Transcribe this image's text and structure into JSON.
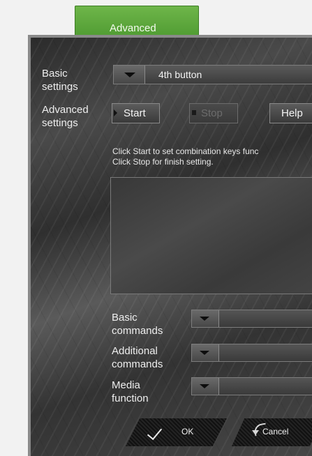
{
  "tab": {
    "label": "Advanced"
  },
  "basic": {
    "label_line1": "Basic",
    "label_line2": "settings",
    "combo_value": "4th button"
  },
  "advanced": {
    "label_line1": "Advanced",
    "label_line2": "settings",
    "start_label": "Start",
    "stop_label": "Stop",
    "help_label": "Help"
  },
  "hint": {
    "line1": "Click Start to set combination keys func",
    "line2": " Click Stop for finish setting."
  },
  "commands": {
    "basic_line1": "Basic",
    "basic_line2": "commands",
    "additional_line1": "Additional",
    "additional_line2": "commands",
    "media_line1": "Media",
    "media_line2": "function"
  },
  "footer": {
    "ok_label": "OK",
    "cancel_label": "Cancel"
  },
  "colors": {
    "tab_green": "#5aa73a",
    "panel_dark": "#3a3a3a"
  }
}
